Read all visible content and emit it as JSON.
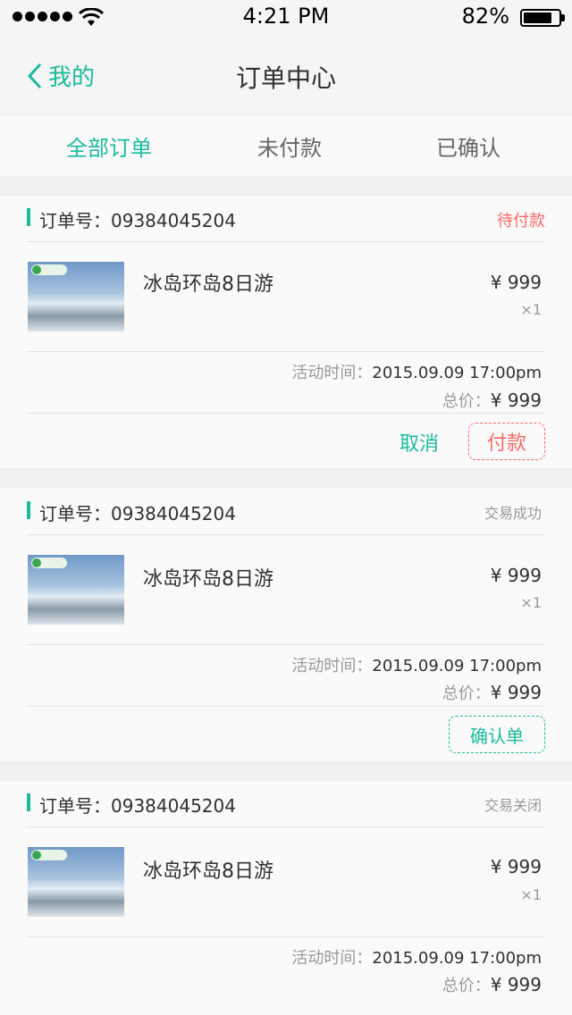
{
  "status_bar": {
    "time": "4:21 PM",
    "battery": "82%",
    "battery_level": 0.82
  },
  "nav": {
    "back_label": "我的",
    "title": "订单中心"
  },
  "tabs": [
    {
      "label": "全部订单",
      "color": "#1abc9c"
    },
    {
      "label": "未付款",
      "color": "#666666"
    },
    {
      "label": "已确认",
      "color": "#666666"
    }
  ],
  "orders": [
    {
      "order_no": "订单号：09384045204",
      "status": "待付款",
      "status_color": "#ff6666",
      "product_name": "冰岛环岛8日游",
      "price": "¥ 999",
      "qty": "×1",
      "time_label": "活动时间：",
      "time_value": "2015.09.09  17:00pm",
      "total_label": "总价：",
      "total_value": "¥ 999",
      "actions": {
        "cancel": "取消",
        "pay": "付款"
      }
    },
    {
      "order_no": "订单号：09384045204",
      "status": "交易成功",
      "status_color": "#999999",
      "product_name": "冰岛环岛8日游",
      "price": "¥ 999",
      "qty": "×1",
      "time_label": "活动时间：",
      "time_value": "2015.09.09  17:00pm",
      "total_label": "总价：",
      "total_value": "¥ 999",
      "actions": {
        "confirm": "确认单"
      }
    },
    {
      "order_no": "订单号：09384045204",
      "status": "交易关闭",
      "status_color": "#999999",
      "product_name": "冰岛环岛8日游",
      "price": "¥ 999",
      "qty": "×1",
      "time_label": "活动时间：",
      "time_value": "2015.09.09  17:00pm",
      "total_label": "总价：",
      "total_value": "¥ 999"
    }
  ],
  "colors": {
    "accent": "#1abc9c",
    "warn": "#ff6666",
    "text": "#303030",
    "muted": "#999999",
    "divider": "#e5e5e5",
    "card": "#fafafa"
  }
}
